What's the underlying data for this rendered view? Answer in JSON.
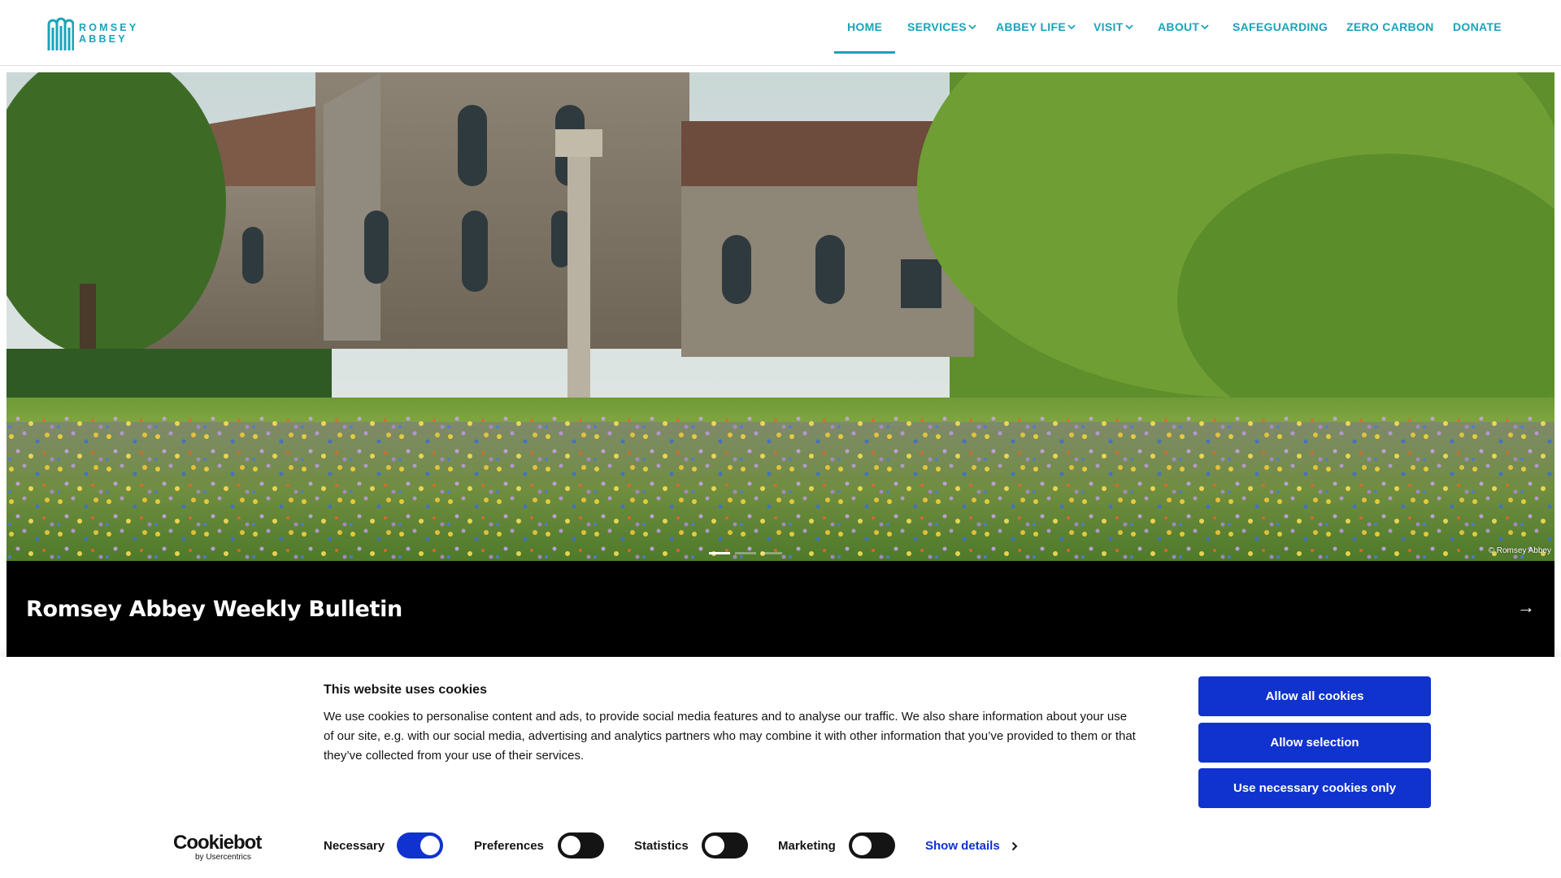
{
  "brand": {
    "logo_line1": "ROMSEY",
    "logo_line2": "ABBEY",
    "accent_color": "#1ba3b8"
  },
  "nav": {
    "items": [
      {
        "label": "HOME",
        "active": true,
        "dropdown": false
      },
      {
        "label": "SERVICES",
        "active": false,
        "dropdown": true
      },
      {
        "label": "ABBEY LIFE",
        "active": false,
        "dropdown": true
      },
      {
        "label": "VISIT",
        "active": false,
        "dropdown": true
      },
      {
        "label": "ABOUT",
        "active": false,
        "dropdown": true
      },
      {
        "label": "SAFEGUARDING",
        "active": false,
        "dropdown": false
      },
      {
        "label": "ZERO CARBON",
        "active": false,
        "dropdown": false
      },
      {
        "label": "DONATE",
        "active": false,
        "dropdown": false
      }
    ]
  },
  "hero": {
    "photo_credit": "© Romsey Abbey",
    "slide_count": 3,
    "active_slide": 1
  },
  "bulletin": {
    "title": "Romsey Abbey Weekly Bulletin",
    "arrow_icon": "arrow-right-icon"
  },
  "cookie_banner": {
    "title": "This website uses cookies",
    "body": "We use cookies to personalise content and ads, to provide social media features and to analyse our traffic. We also share information about your use of our site, e.g. with our social media, advertising and analytics partners who may combine it with other information that you’ve provided to them or that they’ve collected from your use of their services.",
    "buttons": {
      "allow_all": "Allow all cookies",
      "allow_selection": "Allow selection",
      "necessary_only": "Use necessary cookies only"
    },
    "button_color": "#1032cf",
    "provider_logo": "Cookiebot",
    "provider_sub": "by Usercentrics",
    "toggles": {
      "necessary": {
        "label": "Necessary",
        "on": true
      },
      "preferences": {
        "label": "Preferences",
        "on": false
      },
      "statistics": {
        "label": "Statistics",
        "on": false
      },
      "marketing": {
        "label": "Marketing",
        "on": false
      }
    },
    "show_details": "Show details"
  }
}
